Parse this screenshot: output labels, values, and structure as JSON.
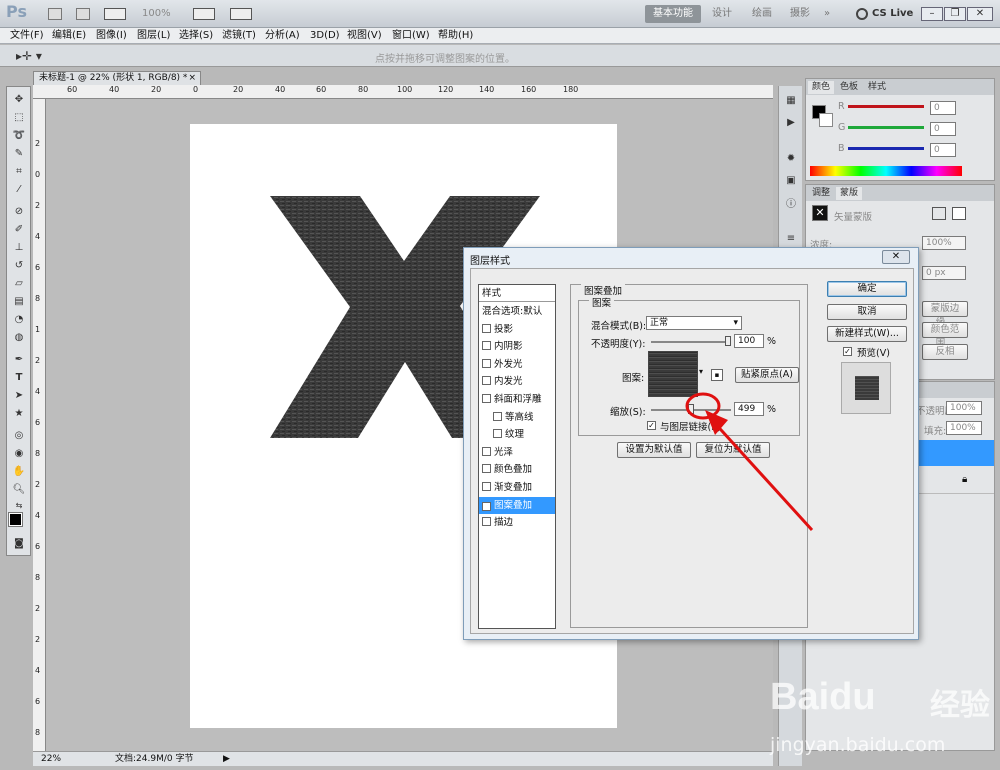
{
  "titlebar": {
    "logo": "Ps",
    "zoom": "100%",
    "workspaces": [
      "基本功能",
      "设计",
      "绘画",
      "摄影",
      "»"
    ],
    "active_workspace": 0,
    "cslive": "CS Live"
  },
  "menubar": {
    "items": [
      "文件(F)",
      "编辑(E)",
      "图像(I)",
      "图层(L)",
      "选择(S)",
      "滤镜(T)",
      "分析(A)",
      "3D(D)",
      "视图(V)",
      "窗口(W)",
      "帮助(H)"
    ]
  },
  "options_bar": {
    "hint": "点按并拖移可调整图案的位置。"
  },
  "document": {
    "tab_title": "未标题-1 @ 22% (形状 1, RGB/8) *",
    "ruler_h": [
      "60",
      "40",
      "20",
      "0",
      "20",
      "40",
      "60",
      "80",
      "100",
      "120",
      "140",
      "160",
      "180"
    ],
    "ruler_v": [
      "2",
      "0",
      "2",
      "4",
      "6",
      "8",
      "1",
      "2",
      "4",
      "6",
      "8",
      "2",
      "4",
      "6",
      "8",
      "2",
      "2",
      "4",
      "6",
      "8"
    ],
    "glyph": "X"
  },
  "status": {
    "zoom": "22%",
    "doc_info": "文档:24.9M/0 字节"
  },
  "color_panel": {
    "tabs": [
      "颜色",
      "色板",
      "样式"
    ],
    "channels": [
      {
        "label": "R",
        "value": "0",
        "color": "#c0141a"
      },
      {
        "label": "G",
        "value": "0",
        "color": "#1ea83a"
      },
      {
        "label": "B",
        "value": "0",
        "color": "#1a28b0"
      }
    ]
  },
  "adjust_panel": {
    "tabs": [
      "调整",
      "蒙版"
    ],
    "mask_label": "矢量蒙版"
  },
  "mask_props": {
    "density_label": "浓度:",
    "density": "100%",
    "feather": "0 px",
    "buttons": [
      "蒙版边缘...",
      "颜色范围...",
      "反相"
    ]
  },
  "layers_panel": {
    "opacity_label": "不透明度:",
    "opacity": "100%",
    "fill_label": "填充:",
    "fill": "100%"
  },
  "dialog": {
    "title": "图层样式",
    "styles_header": "样式",
    "styles": [
      {
        "label": "混合选项:默认",
        "checkbox": false,
        "checked": false,
        "indent": false
      },
      {
        "label": "投影",
        "checkbox": true,
        "checked": false,
        "indent": false
      },
      {
        "label": "内阴影",
        "checkbox": true,
        "checked": false,
        "indent": false
      },
      {
        "label": "外发光",
        "checkbox": true,
        "checked": false,
        "indent": false
      },
      {
        "label": "内发光",
        "checkbox": true,
        "checked": false,
        "indent": false
      },
      {
        "label": "斜面和浮雕",
        "checkbox": true,
        "checked": false,
        "indent": false
      },
      {
        "label": "等高线",
        "checkbox": true,
        "checked": false,
        "indent": true
      },
      {
        "label": "纹理",
        "checkbox": true,
        "checked": false,
        "indent": true
      },
      {
        "label": "光泽",
        "checkbox": true,
        "checked": false,
        "indent": false
      },
      {
        "label": "颜色叠加",
        "checkbox": true,
        "checked": false,
        "indent": false
      },
      {
        "label": "渐变叠加",
        "checkbox": true,
        "checked": false,
        "indent": false
      },
      {
        "label": "图案叠加",
        "checkbox": true,
        "checked": true,
        "indent": false,
        "selected": true
      },
      {
        "label": "描边",
        "checkbox": true,
        "checked": false,
        "indent": false
      }
    ],
    "section_title": "图案叠加",
    "group_title": "图案",
    "blend_label": "混合模式(B):",
    "blend_value": "正常",
    "opacity_label": "不透明度(Y):",
    "opacity_value": "100",
    "opacity_level": 1.0,
    "percent": "%",
    "pattern_label": "图案:",
    "snap_button": "贴紧原点(A)",
    "scale_label": "缩放(S):",
    "scale_value": "499",
    "scale_level": 0.5,
    "link_label": "与图层链接(K)",
    "set_default": "设置为默认值",
    "reset_default": "复位为默认值",
    "ok": "确定",
    "cancel": "取消",
    "new_style": "新建样式(W)...",
    "preview": "预览(V)"
  },
  "watermark": {
    "brand": "Baidu",
    "cn": "经验",
    "url": "jingyan.baidu.com"
  }
}
